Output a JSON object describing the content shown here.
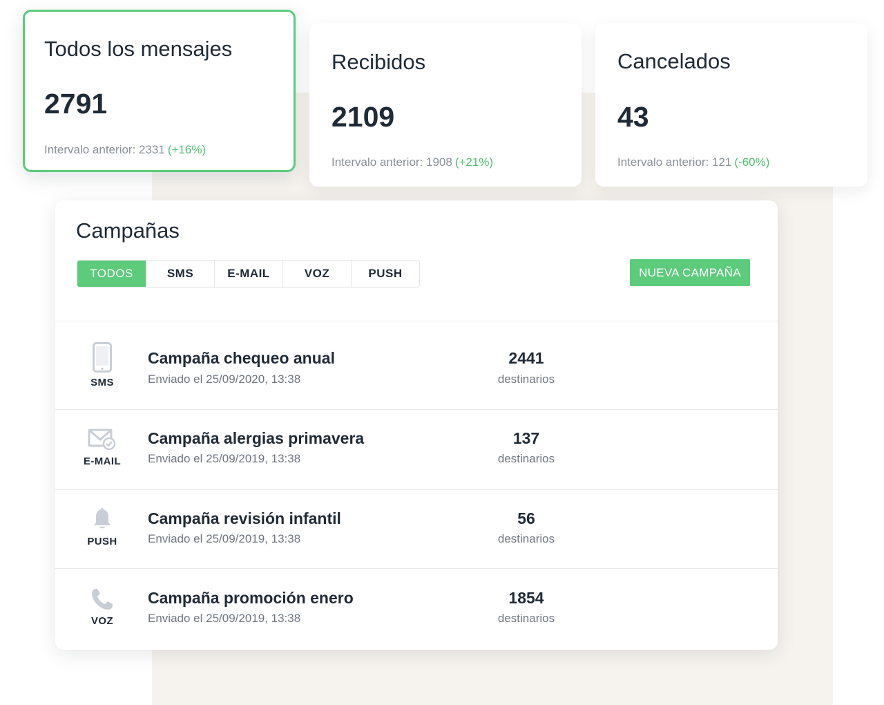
{
  "stats": [
    {
      "title": "Todos los mensajes",
      "value": "2791",
      "prev": "Intervalo anterior: 2331",
      "pct": "(+16%)"
    },
    {
      "title": "Recibidos",
      "value": "2109",
      "prev": "Intervalo anterior: 1908",
      "pct": "(+21%)"
    },
    {
      "title": "Cancelados",
      "value": "43",
      "prev": "Intervalo anterior: 121",
      "pct": "(-60%)"
    }
  ],
  "campaigns": {
    "title": "Campañas",
    "tabs": [
      "TODOS",
      "SMS",
      "E-MAIL",
      "VOZ",
      "PUSH"
    ],
    "active_tab": "TODOS",
    "new_button": "NUEVA CAMPAÑA",
    "rows": [
      {
        "type": "SMS",
        "icon": "phone-icon",
        "name": "Campaña chequeo anual",
        "date": "Enviado el 25/09/2020, 13:38",
        "count": "2441",
        "count_label": "destinarios"
      },
      {
        "type": "E-MAIL",
        "icon": "mail-check-icon",
        "name": "Campaña alergias primavera",
        "date": "Enviado el 25/09/2019, 13:38",
        "count": "137",
        "count_label": "destinarios"
      },
      {
        "type": "PUSH",
        "icon": "bell-icon",
        "name": "Campaña revisión infantil",
        "date": "Enviado el 25/09/2019, 13:38",
        "count": "56",
        "count_label": "destinarios"
      },
      {
        "type": "VOZ",
        "icon": "handset-icon",
        "name": "Campaña promoción enero",
        "date": "Enviado el 25/09/2019, 13:38",
        "count": "1854",
        "count_label": "destinarios"
      }
    ]
  },
  "colors": {
    "accent": "#5ccb7c",
    "positive": "#4cc070",
    "backdrop": "#f6f3ee",
    "icon": "#c9ced6"
  }
}
